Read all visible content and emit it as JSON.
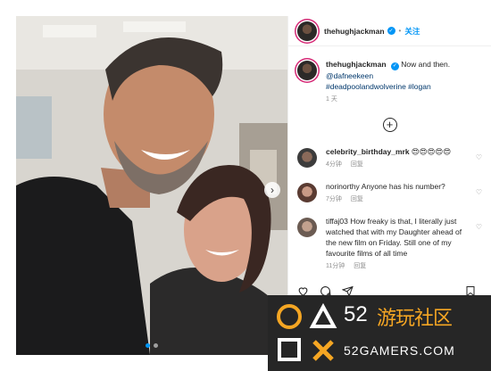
{
  "post": {
    "username": "thehughjackman",
    "follow_label": "关注",
    "separator": "•",
    "caption_text": "Now and then.",
    "caption_mention": "@dafneekeen",
    "caption_tags": "#deadpoolandwolverine #logan",
    "posted_time": "1 天",
    "load_more_icon": "plus-circle-icon"
  },
  "comments": [
    {
      "username": "celebrity_birthday_mrk",
      "text": "😍😍😍😍😍",
      "time": "4分钟",
      "reply_label": "回复"
    },
    {
      "username": "norinorthy",
      "text": "Anyone has his number?",
      "time": "7分钟",
      "reply_label": "回复"
    },
    {
      "username": "tiffaj03",
      "text": "How freaky is that, I literally just watched that with my Daughter ahead of the new film on Friday. Still one of my favourite films of all time",
      "time": "11分钟",
      "reply_label": "回复"
    }
  ],
  "actions": {
    "icons": [
      "heart-icon",
      "comment-icon",
      "share-icon",
      "bookmark-icon"
    ]
  },
  "carousel": {
    "count": 2,
    "active_index": 0
  },
  "watermark": {
    "number": "52",
    "title": "游玩社区",
    "site": "52GAMERS.COM"
  },
  "colors": {
    "accent": "#0095f6",
    "watermark_bg": "#262626",
    "watermark_title": "#f5a623"
  }
}
